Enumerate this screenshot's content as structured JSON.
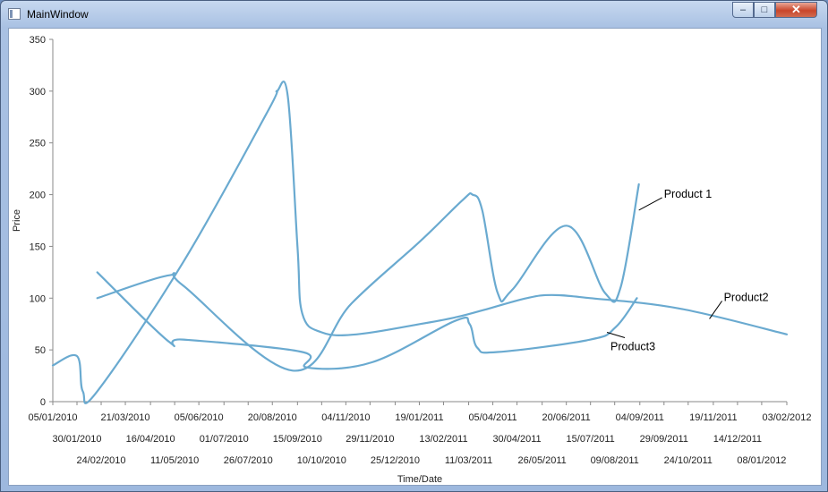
{
  "window": {
    "title": "MainWindow"
  },
  "controls": {
    "minimize": "–",
    "maximize": "□",
    "close": "✕"
  },
  "chart_data": {
    "type": "line",
    "ylabel": "Price",
    "xlabel": "Time/Date",
    "ylim": [
      0,
      350
    ],
    "y_ticks": [
      "0",
      "50",
      "100",
      "150",
      "200",
      "250",
      "300",
      "350"
    ],
    "x_ticks": [
      "05/01/2010",
      "30/01/2010",
      "24/02/2010",
      "21/03/2010",
      "16/04/2010",
      "11/05/2010",
      "05/06/2010",
      "01/07/2010",
      "26/07/2010",
      "20/08/2010",
      "15/09/2010",
      "10/10/2010",
      "04/11/2010",
      "29/11/2010",
      "25/12/2010",
      "19/01/2011",
      "13/02/2011",
      "11/03/2011",
      "05/04/2011",
      "30/04/2011",
      "26/05/2011",
      "20/06/2011",
      "15/07/2011",
      "09/08/2011",
      "04/09/2011",
      "29/09/2011",
      "24/10/2011",
      "19/11/2011",
      "14/12/2011",
      "08/01/2012",
      "03/02/2012"
    ],
    "color": "#6aaad0",
    "grid": false,
    "series": [
      {
        "name": "Product 1",
        "points": [
          [
            "2010-02-20",
            125
          ],
          [
            "2010-05-05",
            58
          ],
          [
            "2010-05-20",
            60
          ],
          [
            "2010-09-20",
            48
          ],
          [
            "2010-09-25",
            33
          ],
          [
            "2010-12-01",
            38
          ],
          [
            "2011-02-25",
            78
          ],
          [
            "2011-03-12",
            75
          ],
          [
            "2011-03-20",
            52
          ],
          [
            "2011-04-10",
            48
          ],
          [
            "2011-07-15",
            60
          ],
          [
            "2011-08-10",
            72
          ],
          [
            "2011-09-01",
            100
          ]
        ]
      },
      {
        "name": "Product2",
        "points": [
          [
            "2010-02-20",
            100
          ],
          [
            "2010-05-05",
            122
          ],
          [
            "2010-05-20",
            112
          ],
          [
            "2010-09-10",
            30
          ],
          [
            "2010-11-10",
            95
          ],
          [
            "2011-01-20",
            155
          ],
          [
            "2011-03-05",
            195
          ],
          [
            "2011-03-15",
            200
          ],
          [
            "2011-03-25",
            185
          ],
          [
            "2011-04-10",
            105
          ],
          [
            "2011-04-25",
            108
          ],
          [
            "2011-06-20",
            170
          ],
          [
            "2011-07-30",
            105
          ],
          [
            "2011-08-15",
            110
          ],
          [
            "2011-09-03",
            210
          ]
        ]
      },
      {
        "name": "Product3",
        "points": [
          [
            "2010-01-05",
            35
          ],
          [
            "2010-01-30",
            44
          ],
          [
            "2010-02-05",
            10
          ],
          [
            "2010-02-20",
            10
          ],
          [
            "2010-05-20",
            135
          ],
          [
            "2010-08-15",
            280
          ],
          [
            "2010-08-25",
            300
          ],
          [
            "2010-09-05",
            295
          ],
          [
            "2010-09-15",
            150
          ],
          [
            "2010-09-20",
            85
          ],
          [
            "2010-10-10",
            67
          ],
          [
            "2010-11-15",
            65
          ],
          [
            "2011-01-20",
            75
          ],
          [
            "2011-02-28",
            82
          ],
          [
            "2011-04-01",
            90
          ],
          [
            "2011-05-10",
            100
          ],
          [
            "2011-06-05",
            103
          ],
          [
            "2011-07-15",
            100
          ],
          [
            "2011-10-15",
            90
          ],
          [
            "2012-02-03",
            65
          ]
        ]
      }
    ],
    "annotations": [
      {
        "text": "Product 1",
        "series": "Product2",
        "x": "2011-09-03",
        "y": 185
      },
      {
        "text": "Product2",
        "series": "Product3",
        "x": "2011-11-15",
        "y": 80
      },
      {
        "text": "Product3",
        "series": "Product 1",
        "x": "2011-08-01",
        "y": 67
      }
    ]
  }
}
